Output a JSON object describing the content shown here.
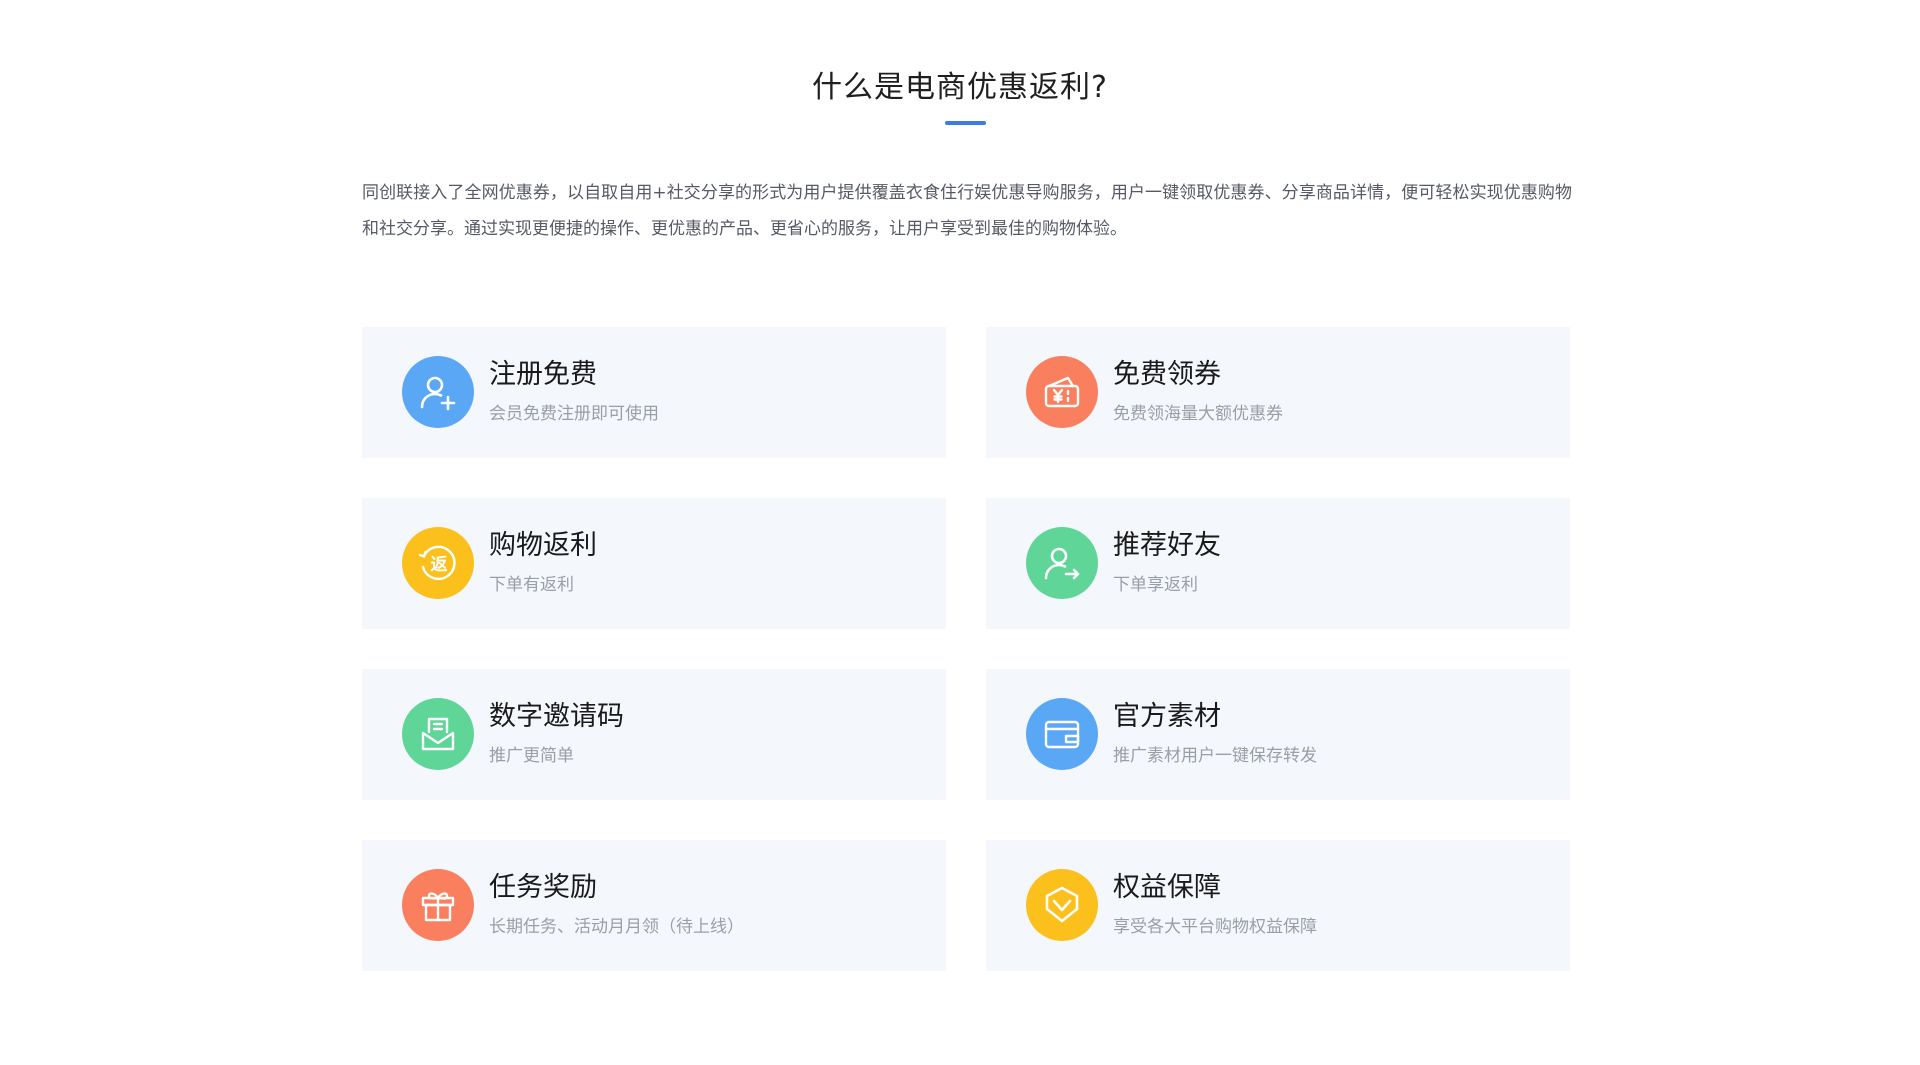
{
  "section": {
    "title": "什么是电商优惠返利?",
    "intro": "同创联接入了全网优惠券，以自取自用+社交分享的形式为用户提供覆盖衣食住行娱优惠导购服务，用户一键领取优惠券、分享商品详情，便可轻松实现优惠购物和社交分享。通过实现更便捷的操作、更优惠的产品、更省心的服务，让用户享受到最佳的购物体验。",
    "accent_color": "#3f7ae6"
  },
  "features": [
    {
      "title": "注册免费",
      "desc": "会员免费注册即可使用",
      "icon": "add-user-icon",
      "color": "#5aa7f5"
    },
    {
      "title": "免费领券",
      "desc": "免费领海量大额优惠券",
      "icon": "coupon-icon",
      "color": "#f97f5f"
    },
    {
      "title": "购物返利",
      "desc": "下单有返利",
      "icon": "rebate-icon",
      "color": "#fcc01d",
      "icon_text": "返"
    },
    {
      "title": "推荐好友",
      "desc": "下单享返利",
      "icon": "share-user-icon",
      "color": "#5fd597"
    },
    {
      "title": "数字邀请码",
      "desc": "推广更简单",
      "icon": "invite-code-icon",
      "color": "#5fd597"
    },
    {
      "title": "官方素材",
      "desc": "推广素材用户一键保存转发",
      "icon": "wallet-icon",
      "color": "#5aa7f5"
    },
    {
      "title": "任务奖励",
      "desc": "长期任务、活动月月领（待上线）",
      "icon": "gift-icon",
      "color": "#f97f5f"
    },
    {
      "title": "权益保障",
      "desc": "享受各大平台购物权益保障",
      "icon": "shield-icon",
      "color": "#fcc01d"
    }
  ]
}
